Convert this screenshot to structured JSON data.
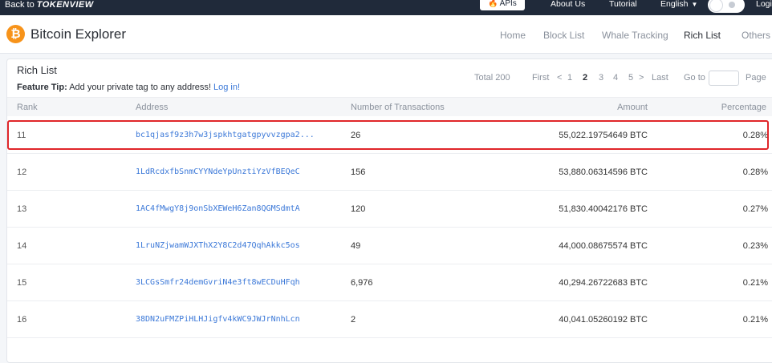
{
  "topbar": {
    "back_label": "Back to",
    "brand": "TOKENVIEW",
    "apis_label": "APIs",
    "about_label": "About Us",
    "tutorial_label": "Tutorial",
    "language_label": "English",
    "login_label": "Logi"
  },
  "header": {
    "logo_symbol": "₿",
    "title": "Bitcoin Explorer",
    "nav": [
      "Home",
      "Block List",
      "Whale Tracking",
      "Rich List",
      "Others"
    ]
  },
  "card": {
    "title": "Rich List",
    "tip_label": "Feature Tip:",
    "tip_text": " Add your private tag to any address! ",
    "tip_link": "Log in!"
  },
  "pagination": {
    "total": "Total 200",
    "first": "First",
    "prev": "<",
    "pages": [
      "1",
      "2",
      "3",
      "4",
      "5"
    ],
    "current_page": "2",
    "next": ">",
    "last": "Last",
    "goto_label": "Go to",
    "goto_value": "",
    "page_label": "Page"
  },
  "table": {
    "columns": [
      "Rank",
      "Address",
      "Number of Transactions",
      "Amount",
      "Percentage"
    ],
    "rows": [
      {
        "rank": "11",
        "address": "bc1qjasf9z3h7w3jspkhtgatgpyvvzgpa2...",
        "tx": "26",
        "amount": "55,022.19754649 BTC",
        "pct": "0.28%"
      },
      {
        "rank": "12",
        "address": "1LdRcdxfbSnmCYYNdeYpUnztiYzVfBEQeC",
        "tx": "156",
        "amount": "53,880.06314596 BTC",
        "pct": "0.28%"
      },
      {
        "rank": "13",
        "address": "1AC4fMwgY8j9onSbXEWeH6Zan8QGMSdmtA",
        "tx": "120",
        "amount": "51,830.40042176 BTC",
        "pct": "0.27%"
      },
      {
        "rank": "14",
        "address": "1LruNZjwamWJXThX2Y8C2d47QqhAkkc5os",
        "tx": "49",
        "amount": "44,000.08675574 BTC",
        "pct": "0.23%"
      },
      {
        "rank": "15",
        "address": "3LCGsSmfr24demGvriN4e3ft8wECDuHFqh",
        "tx": "6,976",
        "amount": "40,294.26722683 BTC",
        "pct": "0.21%"
      },
      {
        "rank": "16",
        "address": "38DN2uFMZPiHLHJigfv4kWC9JWJrNnhLcn",
        "tx": "2",
        "amount": "40,041.05260192 BTC",
        "pct": "0.21%"
      }
    ]
  },
  "colors": {
    "topbar_bg": "#202a3a",
    "accent_link": "#3b78d8",
    "highlight_border": "#e0262a",
    "bitcoin_orange": "#f7931a"
  }
}
